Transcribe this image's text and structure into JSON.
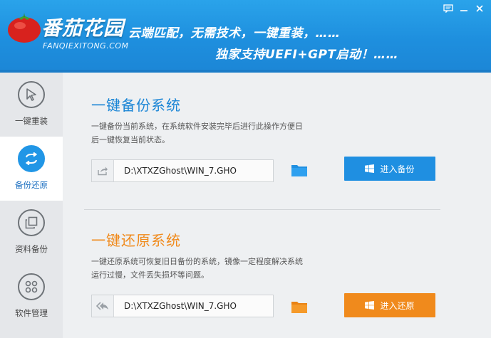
{
  "header": {
    "title": "番茄花园",
    "subtitle": "FANQIEXITONG.COM",
    "slogan_line1": "云端匹配，无需技术，一键重装，……",
    "slogan_line2": "独家支持UEFI+GPT启动！……",
    "window_buttons": [
      "feedback-icon",
      "minimize-icon",
      "close-icon"
    ]
  },
  "sidebar": {
    "items": [
      {
        "label": "一键重装",
        "icon": "cursor-icon",
        "active": false
      },
      {
        "label": "备份还原",
        "icon": "sync-icon",
        "active": true
      },
      {
        "label": "资料备份",
        "icon": "copy-icon",
        "active": false
      },
      {
        "label": "软件管理",
        "icon": "grid-icon",
        "active": false
      }
    ]
  },
  "backup": {
    "title": "一键备份系统",
    "desc": "一键备份当前系统，在系统软件安装完毕后进行此操作方便日后一键恢复当前状态。",
    "path": "D:\\XTXZGhost\\WIN_7.GHO",
    "button": "进入备份"
  },
  "restore": {
    "title": "一键还原系统",
    "desc": "一键还原系统可恢复旧日备份的系统，镜像一定程度解决系统运行过慢，文件丢失损坏等问题。",
    "path": "D:\\XTXZGhost\\WIN_7.GHO",
    "button": "进入还原"
  },
  "colors": {
    "header_blue": "#1e8fde",
    "accent_blue": "#1f8fe1",
    "accent_orange": "#f08a1c",
    "sidebar_bg": "#e5e7ea"
  }
}
